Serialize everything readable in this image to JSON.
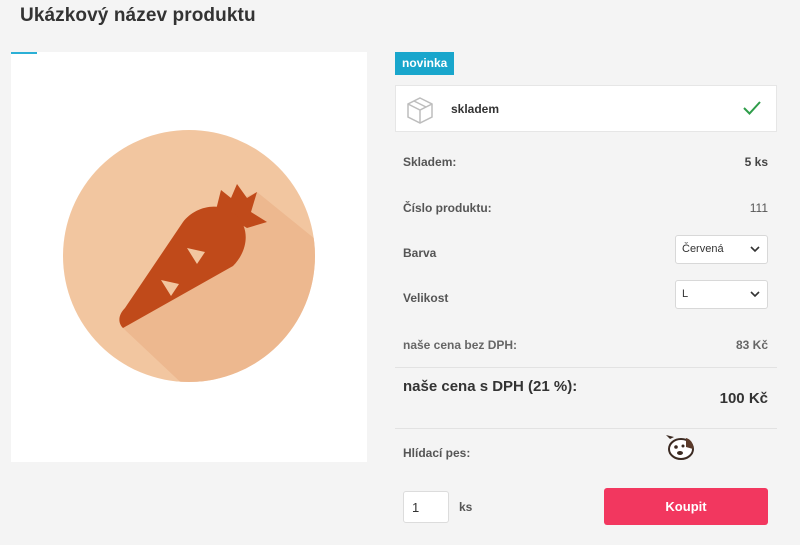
{
  "page": {
    "title": "Ukázkový název produktu"
  },
  "badge": {
    "label": "novinka"
  },
  "stock": {
    "label": "skladem"
  },
  "details": {
    "in_stock_label": "Skladem:",
    "in_stock_value": "5 ks",
    "product_number_label": "Číslo produktu:",
    "product_number_value": "111",
    "color_label": "Barva",
    "color_selected": "Červená",
    "size_label": "Velikost",
    "size_selected": "L",
    "price_ex_vat_label": "naše cena bez DPH:",
    "price_ex_vat_value": "83 Kč",
    "price_inc_vat_label": "naše cena s DPH (21 %):",
    "price_inc_vat_value": "100 Kč",
    "watchdog_label": "Hlídací pes:"
  },
  "cart": {
    "quantity": "1",
    "unit": "ks",
    "buy_label": "Koupit"
  },
  "icons": {
    "product_image": "carrot-icon",
    "stock": "box-icon",
    "stock_status": "check-icon",
    "watchdog": "dog-icon",
    "select": "chevron-down-icon"
  },
  "colors": {
    "badge": "#19a6cc",
    "buy_button": "#f2375f",
    "check": "#2e9d4a",
    "carrot": "#c04a1a",
    "circle": "#f2c6a0"
  }
}
